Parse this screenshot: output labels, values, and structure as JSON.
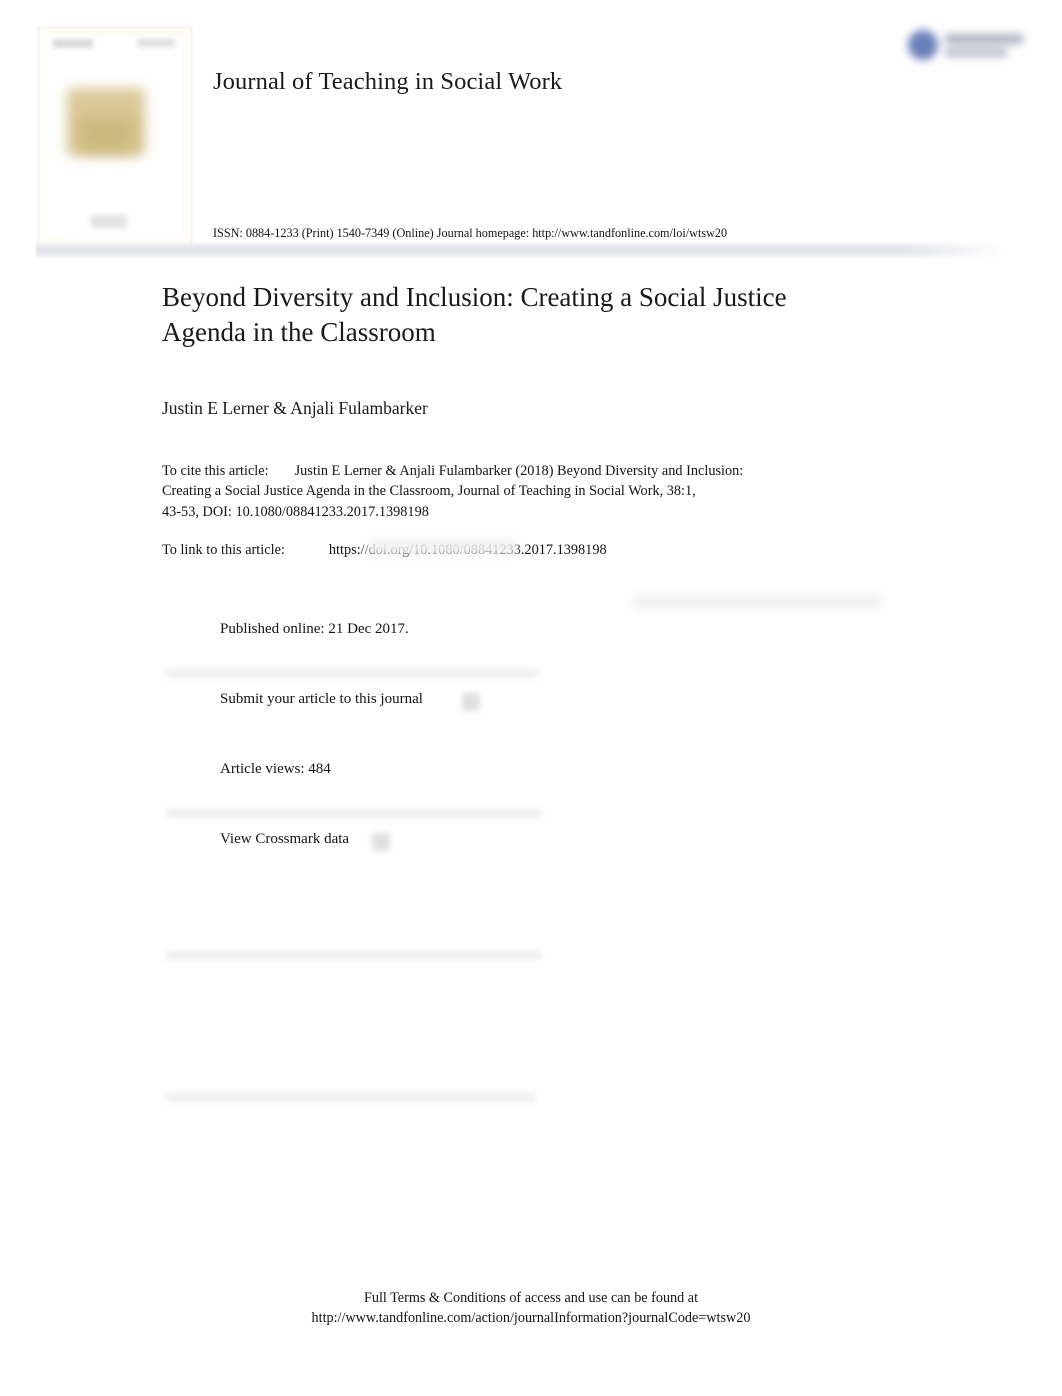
{
  "masthead": {
    "journal_title": "Journal of Teaching in Social Work",
    "issn_line": "ISSN: 0884-1233 (Print) 1540-7349 (Online) Journal homepage: http://www.tandfonline.com/loi/wtsw20",
    "publisher_logo_name": "Taylor & Francis",
    "cover_thumbnail_alt": "Journal of Teaching in Social Work cover",
    "logo_accent_color": "#4b63ab",
    "band_color": "#dfe1e7"
  },
  "article": {
    "title": "Beyond Diversity and Inclusion: Creating a Social Justice Agenda in the Classroom",
    "authors": "Justin E Lerner & Anjali Fulambarker",
    "cite": {
      "label": "To cite this article:",
      "line1": "Justin E Lerner & Anjali Fulambarker (2018) Beyond Diversity and Inclusion:",
      "line2": "Creating a Social Justice Agenda in the Classroom, Journal of Teaching in Social Work, 38:1,",
      "line3": "43-53, DOI: 10.1080/08841233.2017.1398198"
    },
    "link": {
      "label": "To link to this article:",
      "url": "https://doi.org/10.1080/08841233.2017.1398198"
    }
  },
  "actions": [
    {
      "label": "Published online: 21 Dec 2017.",
      "icon": "calendar-icon",
      "has_external_icon": false
    },
    {
      "label": "Submit your article to this journal",
      "icon": "pencil-icon",
      "has_external_icon": true
    },
    {
      "label": "Article views: 484",
      "icon": "eye-icon",
      "has_external_icon": false
    },
    {
      "label": "View Crossmark data",
      "icon": "crossmark-icon",
      "has_external_icon": true
    }
  ],
  "footer": {
    "line1": "Full Terms & Conditions of access and use can be found at",
    "line2": "http://www.tandfonline.com/action/journalInformation?journalCode=wtsw20"
  }
}
